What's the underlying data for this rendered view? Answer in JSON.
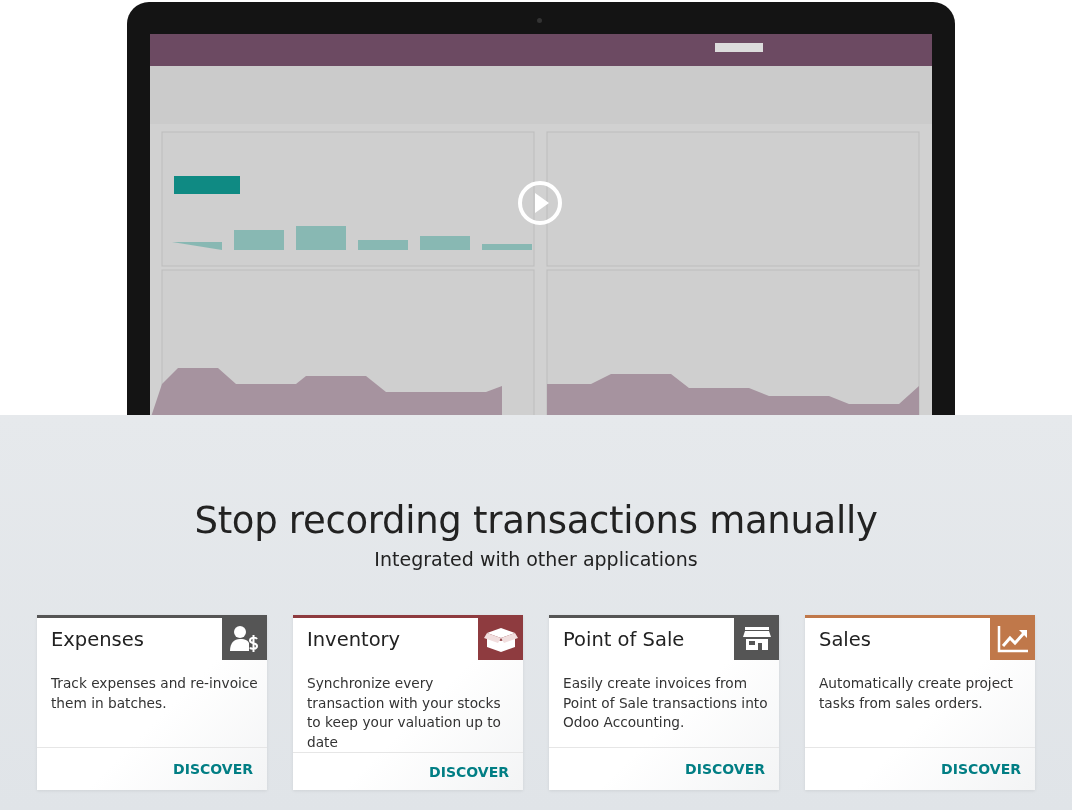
{
  "heading": "Stop recording transactions manually",
  "subheading": "Integrated with other applications",
  "features": [
    {
      "kind": "expenses",
      "title": "Expenses",
      "color": "#555555",
      "description": "Track expenses and re-invoice them in batches.",
      "link": "DISCOVER"
    },
    {
      "kind": "inventory",
      "title": "Inventory",
      "color": "#8e3b3f",
      "description": "Synchronize every transaction with your stocks to keep your valuation up to date",
      "link": "DISCOVER"
    },
    {
      "kind": "point_of_sale",
      "title": "Point of Sale",
      "color": "#555555",
      "description": "Easily create invoices from Point of Sale transactions into Odoo Accounting.",
      "link": "DISCOVER"
    },
    {
      "kind": "sales",
      "title": "Sales",
      "color": "#c0784a",
      "description": "Automatically create project tasks from sales orders.",
      "link": "DISCOVER"
    }
  ]
}
